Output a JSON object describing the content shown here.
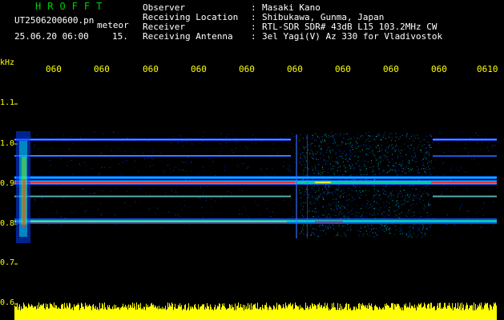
{
  "app": {
    "title": "HROFFT",
    "file_name": "UT2506200600.pn",
    "file_suffix": "meteor",
    "timestamp": "25.06.20 06:00",
    "frame": "15."
  },
  "header": {
    "fields": [
      {
        "label": "Observer",
        "value": "Masaki Kano"
      },
      {
        "label": "Receiving Location",
        "value": "Shibukawa, Gunma, Japan"
      },
      {
        "label": "Receiver",
        "value": "RTL-SDR SDR# 43dB L15 103.2MHz CW"
      },
      {
        "label": "Receiving Antenna",
        "value": "3el Yagi(V) Az 330 for Vladivostok"
      }
    ],
    "separator": ":"
  },
  "spectrogram": {
    "y_unit": "kHz",
    "y_ticks": [
      "1.1",
      "1.0",
      "0.9",
      "0.8",
      "0.7",
      "0.6"
    ],
    "x_ticks": [
      "060",
      "060",
      "060",
      "060",
      "060",
      "060",
      "060",
      "060",
      "060",
      "0610"
    ],
    "colors": {
      "background": "#000000",
      "text_header": "#ffffff",
      "text_axis": "#ffff00",
      "title": "#00d000",
      "signal_low": "#0033ff",
      "signal_mid": "#00ffff",
      "signal_high": "#ff2020",
      "power_bar": "#ffff00"
    }
  },
  "chart_data": {
    "type": "heatmap",
    "ylabel": "kHz",
    "ylim": [
      0.6,
      1.15
    ],
    "x_tick_labels": [
      "060",
      "060",
      "060",
      "060",
      "060",
      "060",
      "060",
      "060",
      "060",
      "0610"
    ],
    "y_tick_labels": [
      "1.1",
      "1.0",
      "0.9",
      "0.8",
      "0.7",
      "0.6"
    ],
    "traces_khz": [
      1.01,
      0.96,
      0.915,
      0.9,
      0.87,
      0.81,
      0.8
    ],
    "gap_x_range_minutes": [
      0.5,
      0.85
    ]
  }
}
